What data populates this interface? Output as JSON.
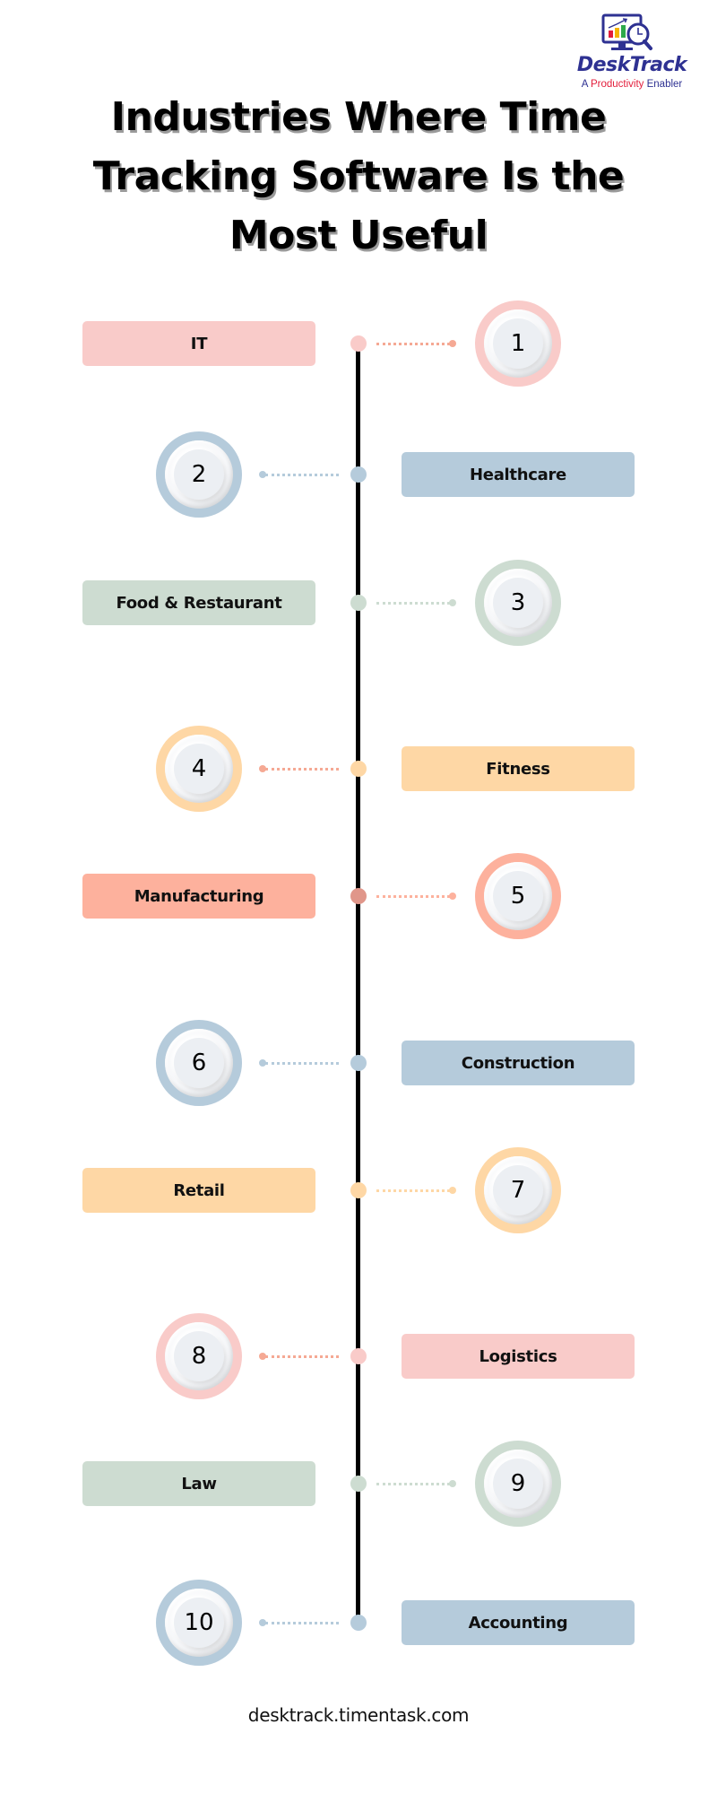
{
  "logo": {
    "name": "DeskTrack",
    "tagline_prefix": "A ",
    "tagline_accent": "Productivity",
    "tagline_suffix": " Enabler",
    "icon": "monitor-chart-clock-icon",
    "colors": {
      "primary": "#2e3192",
      "accent": "#e31e3c"
    }
  },
  "title": "Industries Where Time Tracking Software Is the Most Useful",
  "items": [
    {
      "number": "1",
      "label": "IT",
      "label_side": "left",
      "color": "#f9cbc9",
      "dot_color": "#f9cbc9",
      "connector_color": "#f5a994"
    },
    {
      "number": "2",
      "label": "Healthcare",
      "label_side": "right",
      "color": "#b5cbdb",
      "dot_color": "#b5cbdb",
      "connector_color": "#b5cbdb"
    },
    {
      "number": "3",
      "label": "Food & Restaurant",
      "label_side": "left",
      "color": "#cddcd1",
      "dot_color": "#cddcd1",
      "connector_color": "#cddcd1"
    },
    {
      "number": "4",
      "label": "Fitness",
      "label_side": "right",
      "color": "#fed7a5",
      "dot_color": "#fed7a5",
      "connector_color": "#f5a994"
    },
    {
      "number": "5",
      "label": "Manufacturing",
      "label_side": "left",
      "color": "#fdb19d",
      "dot_color": "#e0968a",
      "connector_color": "#fdb19d"
    },
    {
      "number": "6",
      "label": "Construction",
      "label_side": "right",
      "color": "#b5cbdb",
      "dot_color": "#b5cbdb",
      "connector_color": "#b5cbdb"
    },
    {
      "number": "7",
      "label": "Retail",
      "label_side": "left",
      "color": "#fed7a5",
      "dot_color": "#fed7a5",
      "connector_color": "#fed7a5"
    },
    {
      "number": "8",
      "label": "Logistics",
      "label_side": "right",
      "color": "#f9cbc9",
      "dot_color": "#f9cbc9",
      "connector_color": "#f5a994"
    },
    {
      "number": "9",
      "label": "Law",
      "label_side": "left",
      "color": "#cddcd1",
      "dot_color": "#cddcd1",
      "connector_color": "#cddcd1"
    },
    {
      "number": "10",
      "label": "Accounting",
      "label_side": "right",
      "color": "#b5cbdb",
      "dot_color": "#b5cbdb",
      "connector_color": "#b5cbdb"
    }
  ],
  "footer": {
    "url": "desktrack.timentask.com"
  }
}
